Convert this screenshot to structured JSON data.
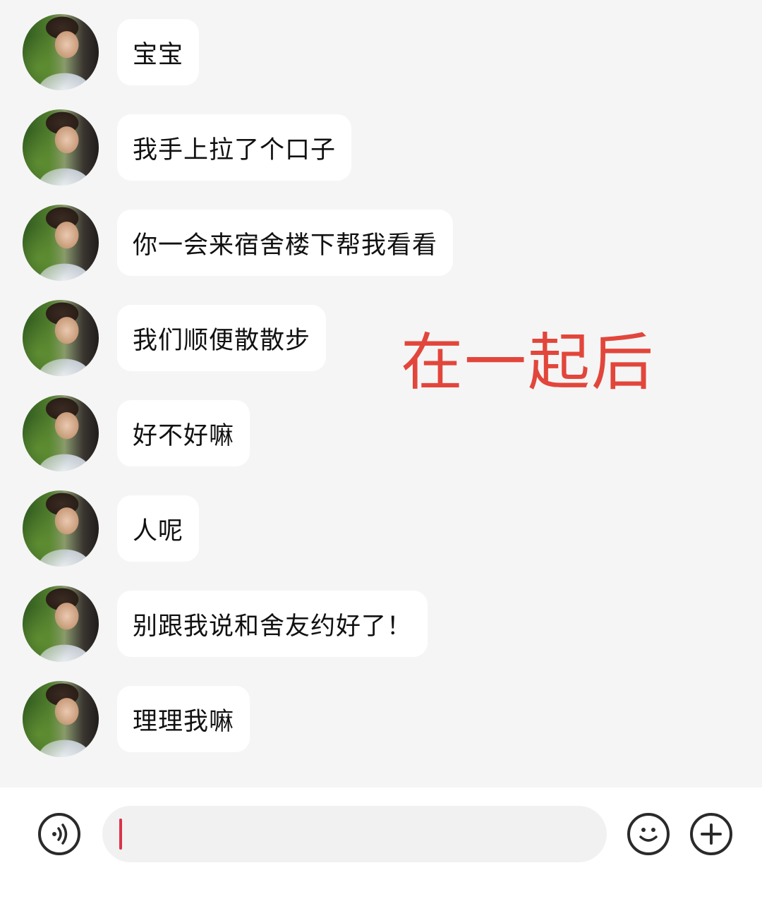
{
  "messages": [
    {
      "text": "宝宝"
    },
    {
      "text": "我手上拉了个口子"
    },
    {
      "text": "你一会来宿舍楼下帮我看看"
    },
    {
      "text": "我们顺便散散步"
    },
    {
      "text": "好不好嘛"
    },
    {
      "text": "人呢"
    },
    {
      "text": "别跟我说和舍友约好了！"
    },
    {
      "text": "理理我嘛"
    }
  ],
  "overlay_caption": "在一起后",
  "input_bar": {
    "voice_icon": "voice-icon",
    "emoji_icon": "emoji-icon",
    "plus_icon": "plus-icon",
    "input_value": ""
  },
  "colors": {
    "background": "#f5f5f5",
    "bubble": "#ffffff",
    "caption": "#e2463b",
    "caret": "#d9344a"
  }
}
